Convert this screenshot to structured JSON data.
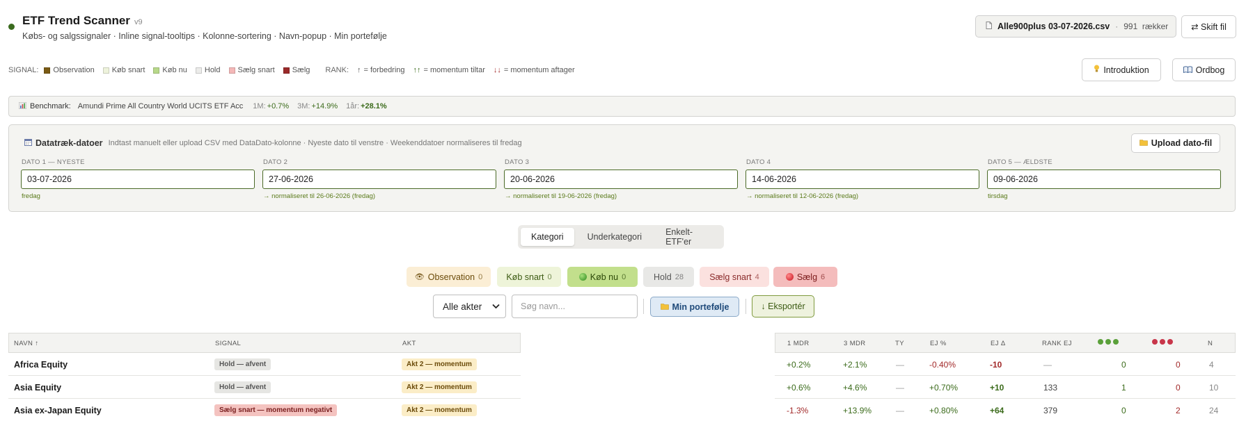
{
  "app": {
    "title": "ETF Trend Scanner",
    "version": "v9",
    "subtitle": "Købs- og salgssignaler · Inline signal-tooltips · Kolonne-sortering · Navn-popup · Min portefølje"
  },
  "file": {
    "icon": "file-icon",
    "name": "Alle900plus 03-07-2026.csv",
    "separator": "·",
    "row_count": "991",
    "rows_label": "rækker",
    "switch_label": "⇄ Skift fil"
  },
  "header_buttons": {
    "intro_label": "Introduktion",
    "intro_icon": "lightbulb-icon",
    "glossary_label": "Ordbog",
    "glossary_icon": "book-icon"
  },
  "legend": {
    "signal_label": "SIGNAL:",
    "items": [
      {
        "label": "Observation",
        "color": "#7a5a14"
      },
      {
        "label": "Køb snart",
        "color": "#eef3dc"
      },
      {
        "label": "Køb nu",
        "color": "#b8d98a"
      },
      {
        "label": "Hold",
        "color": "#ececea"
      },
      {
        "label": "Sælg snart",
        "color": "#f4b8b8"
      },
      {
        "label": "Sælg",
        "color": "#9a2a2a"
      }
    ],
    "rank_label": "RANK:",
    "rank_items": [
      {
        "arrow": "↑",
        "text": "= forbedring",
        "color": "#555555"
      },
      {
        "arrow": "↑↑",
        "text": "= momentum tiltar",
        "color": "#3b6b1b"
      },
      {
        "arrow": "↓↓",
        "text": "= momentum aftager",
        "color": "#a22a2a"
      }
    ]
  },
  "benchmark": {
    "icon": "bar-chart-icon",
    "label": "Benchmark:",
    "name": "Amundi Prime All Country World UCITS ETF Acc",
    "periods": [
      {
        "label": "1M:",
        "value": "+0.7%",
        "bold": false
      },
      {
        "label": "3M:",
        "value": "+14.9%",
        "bold": false
      },
      {
        "label": "1år:",
        "value": "+28.1%",
        "bold": true
      }
    ]
  },
  "dates": {
    "icon": "calendar-icon",
    "title": "Datatræk-datoer",
    "note": "Indtast manuelt eller upload CSV med DataDato-kolonne · Nyeste dato til venstre · Weekenddatoer normaliseres til fredag",
    "upload_label": "Upload dato-fil",
    "upload_icon": "folder-icon",
    "fields": [
      {
        "label": "DATO 1 — NYESTE",
        "value": "03-07-2026",
        "note": "fredag"
      },
      {
        "label": "DATO 2",
        "value": "27-06-2026",
        "note": "→ normaliseret til 26-06-2026 (fredag)"
      },
      {
        "label": "DATO 3",
        "value": "20-06-2026",
        "note": "→ normaliseret til 19-06-2026 (fredag)"
      },
      {
        "label": "DATO 4",
        "value": "14-06-2026",
        "note": "→ normaliseret til 12-06-2026 (fredag)"
      },
      {
        "label": "DATO 5 — ÆLDSTE",
        "value": "09-06-2026",
        "note": "tirsdag"
      }
    ]
  },
  "tabs": [
    {
      "label": "Kategori",
      "active": true
    },
    {
      "label": "Underkategori",
      "active": false
    },
    {
      "label": "Enkelt-ETF'er",
      "active": false
    }
  ],
  "signal_chips": [
    {
      "label": "Observation",
      "count": "0",
      "bg": "#fbeed5",
      "fg": "#6b4b0a",
      "icon": "eye-icon",
      "glyph": "👁"
    },
    {
      "label": "Køb snart",
      "count": "0",
      "bg": "#eef4d9",
      "fg": "#3b5a12",
      "icon": "",
      "glyph": ""
    },
    {
      "label": "Køb nu",
      "count": "0",
      "bg": "#c2df8c",
      "fg": "#2d4a0a",
      "icon": "green-ball-icon",
      "glyph": "ball-green"
    },
    {
      "label": "Hold",
      "count": "28",
      "bg": "#e8e8e6",
      "fg": "#555555",
      "icon": "",
      "glyph": ""
    },
    {
      "label": "Sælg snart",
      "count": "4",
      "bg": "#fbe1df",
      "fg": "#8a2a2a",
      "icon": "",
      "glyph": ""
    },
    {
      "label": "Sælg",
      "count": "6",
      "bg": "#f4bcbc",
      "fg": "#7a1a1a",
      "icon": "red-ball-icon",
      "glyph": "ball-red"
    }
  ],
  "filters": {
    "akt_select_value": "Alle akter",
    "search_placeholder": "Søg navn...",
    "portfolio_label": "Min portefølje",
    "portfolio_icon": "folder-icon",
    "export_label": "↓ Eksportér"
  },
  "table": {
    "left_headers": [
      "NAVN ↑",
      "SIGNAL",
      "AKT"
    ],
    "right_headers": [
      "1 MDR",
      "3 MDR",
      "TY",
      "EJ %",
      "EJ Δ",
      "RANK EJ",
      "",
      "",
      "N"
    ],
    "green_dots_color": "#5aa03a",
    "red_dots_color": "#c8364a",
    "rows": [
      {
        "name": "Africa Equity",
        "signal": "Hold — afvent",
        "signal_kind": "hold",
        "akt": "Akt 2 — momentum",
        "m1": "+0.2%",
        "m3": "+2.1%",
        "ty": "—",
        "ejp": "-0.40%",
        "ejd": "-10",
        "rank": "—",
        "g": "0",
        "r": "0",
        "n": "4"
      },
      {
        "name": "Asia Equity",
        "signal": "Hold — afvent",
        "signal_kind": "hold",
        "akt": "Akt 2 — momentum",
        "m1": "+0.6%",
        "m3": "+4.6%",
        "ty": "—",
        "ejp": "+0.70%",
        "ejd": "+10",
        "rank": "133",
        "g": "1",
        "r": "0",
        "n": "10"
      },
      {
        "name": "Asia ex-Japan Equity",
        "signal": "Sælg snart — momentum negativt",
        "signal_kind": "saeg-snart",
        "akt": "Akt 2 — momentum",
        "m1": "-1.3%",
        "m3": "+13.9%",
        "ty": "—",
        "ejp": "+0.80%",
        "ejd": "+64",
        "rank": "379",
        "g": "0",
        "r": "2",
        "n": "24"
      }
    ]
  }
}
